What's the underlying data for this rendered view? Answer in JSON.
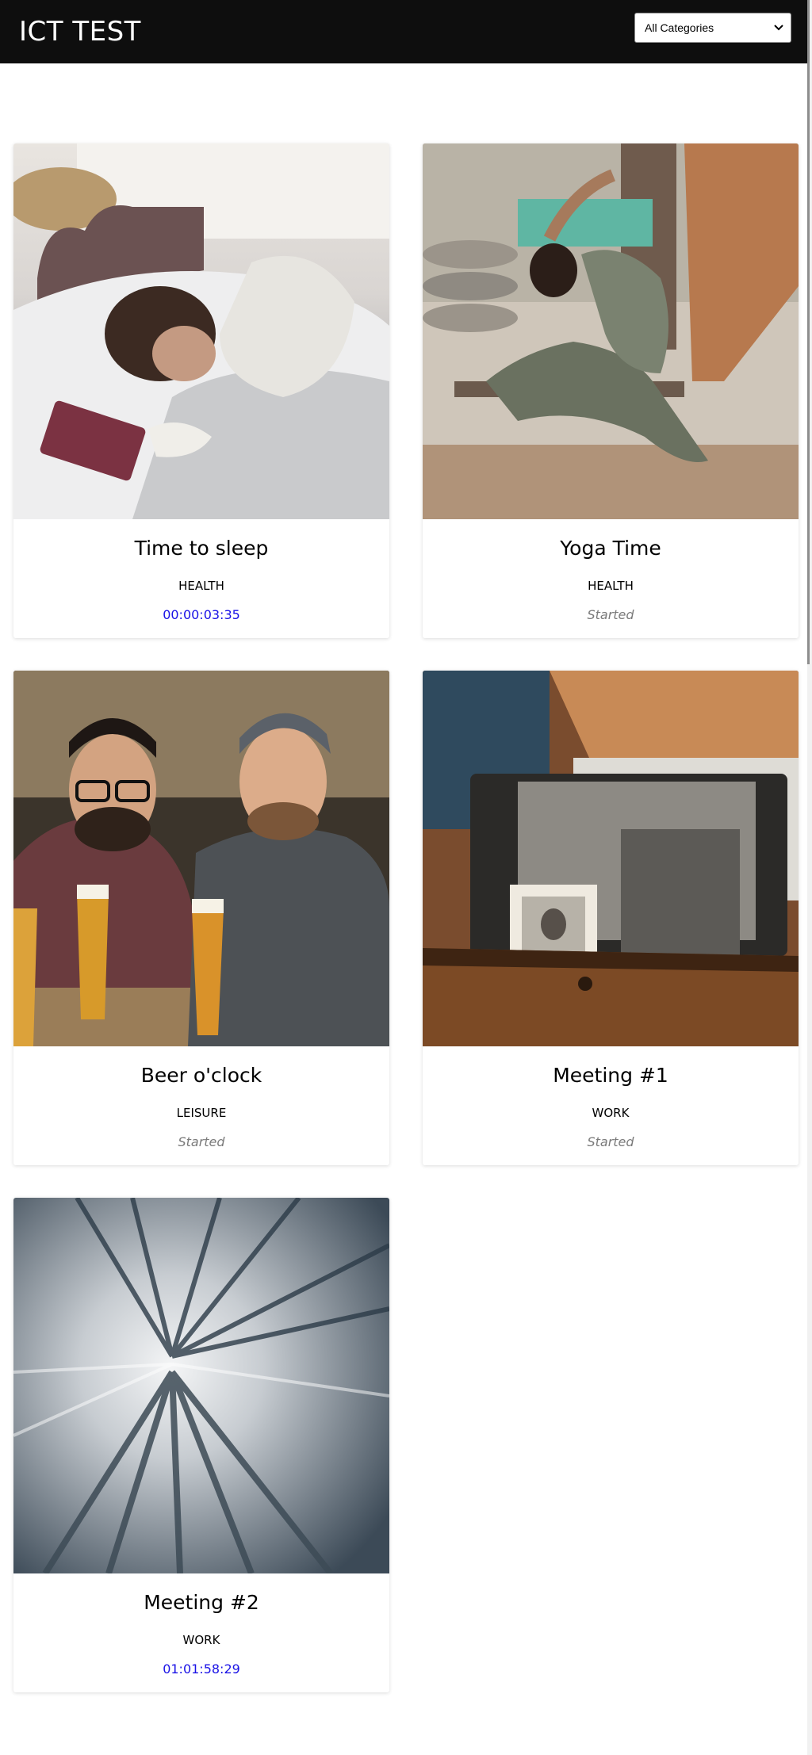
{
  "header": {
    "title": "ICT TEST",
    "category_select": {
      "selected": "All Categories"
    }
  },
  "events": [
    {
      "title": "Time to sleep",
      "category": "HEALTH",
      "status": "00:00:03:35",
      "status_type": "timer",
      "image": "woman-sleeping-photo"
    },
    {
      "title": "Yoga Time",
      "category": "HEALTH",
      "status": "Started",
      "status_type": "started",
      "image": "yoga-pose-photo"
    },
    {
      "title": "Beer o'clock",
      "category": "LEISURE",
      "status": "Started",
      "status_type": "started",
      "image": "friends-with-beer-photo"
    },
    {
      "title": "Meeting #1",
      "category": "WORK",
      "status": "Started",
      "status_type": "started",
      "image": "old-photos-box-photo"
    },
    {
      "title": "Meeting #2",
      "category": "WORK",
      "status": "01:01:58:29",
      "status_type": "timer",
      "image": "tunnel-motion-photo"
    }
  ],
  "colors": {
    "header_bg": "#0e0e0e",
    "timer_text": "#1a12e6",
    "started_text": "#7a7a7a"
  }
}
